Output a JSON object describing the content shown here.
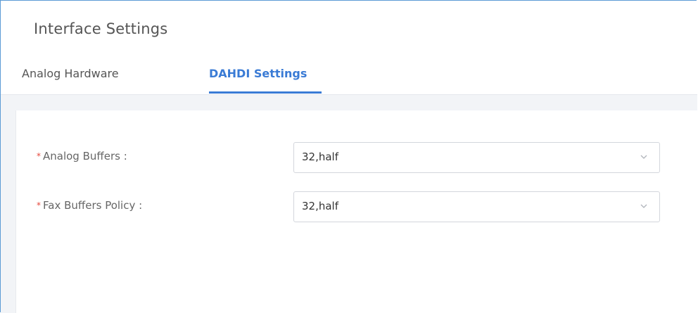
{
  "page": {
    "title": "Interface Settings"
  },
  "tabs": [
    {
      "label": "Analog Hardware",
      "active": false
    },
    {
      "label": "DAHDI Settings",
      "active": true
    }
  ],
  "form": {
    "required_marker": "*",
    "fields": [
      {
        "label": "Analog Buffers :",
        "value": "32,half"
      },
      {
        "label": "Fax Buffers Policy :",
        "value": "32,half"
      }
    ]
  },
  "colors": {
    "accent": "#3a7bd5",
    "required": "#e5483c",
    "frame_border": "#5b9bd5"
  },
  "icons": {
    "dropdown": "chevron-down-icon"
  }
}
